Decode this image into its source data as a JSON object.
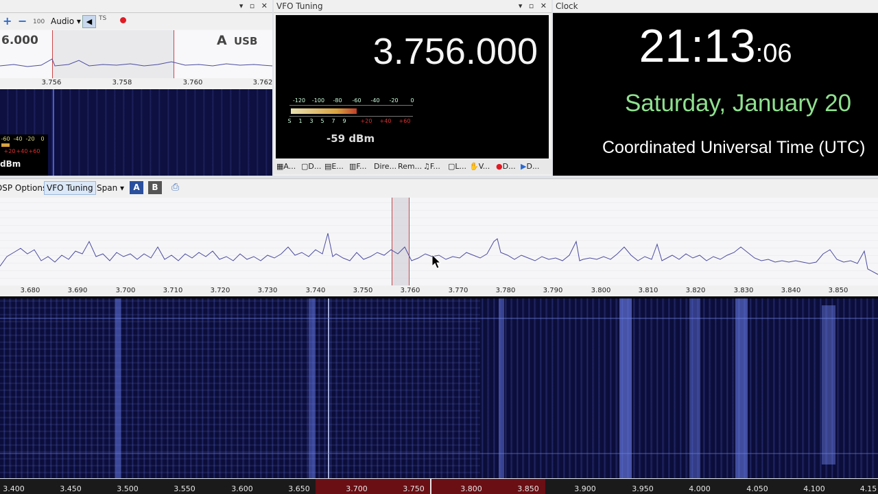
{
  "left_panel": {
    "toolbar": {
      "plus": "+",
      "minus": "−",
      "level": "100",
      "audio_label": "Audio",
      "record_icon": "record-icon"
    },
    "freq_partial": "6.000",
    "vfo_letter": "A",
    "mode": "USB",
    "ticks": [
      "3.756",
      "3.758",
      "3.760",
      "3.762"
    ],
    "meter_labels": [
      "-60",
      "-40",
      "-20",
      "0"
    ],
    "meter_red": [
      "+20",
      "+40",
      "+60"
    ],
    "dbm_partial": "dBm"
  },
  "vfo_panel": {
    "title": "VFO Tuning",
    "frequency": "3.756.000",
    "meter_labels": [
      "-120",
      "-100",
      "-80",
      "-60",
      "-40",
      "-20",
      "0"
    ],
    "s_labels": [
      "S",
      "1",
      "3",
      "5",
      "7",
      "9"
    ],
    "plus_labels": [
      "+20",
      "+40",
      "+60"
    ],
    "dbm": "-59 dBm",
    "tabs": [
      "A...",
      "D...",
      "E...",
      "F...",
      "Dire...",
      "Rem...",
      "F...",
      "L...",
      "V...",
      "D...",
      "D..."
    ]
  },
  "clock_panel": {
    "title": "Clock",
    "time_main": "21:13",
    "time_seconds": ":06",
    "date": "Saturday, January 20",
    "timezone": "Coordinated Universal Time (UTC)"
  },
  "main_toolbar": {
    "dsp_options": "DSP Options",
    "vfo_tuning": "VFO Tuning",
    "span": "Span",
    "a": "A",
    "b": "B"
  },
  "spectrum": {
    "ticks": [
      "3.680",
      "3.690",
      "3.700",
      "3.710",
      "3.720",
      "3.730",
      "3.740",
      "3.750",
      "3.760",
      "3.770",
      "3.780",
      "3.790",
      "3.800",
      "3.810",
      "3.820",
      "3.830",
      "3.840",
      "3.850"
    ]
  },
  "bottom_scale": {
    "ticks": [
      "3.400",
      "3.450",
      "3.500",
      "3.550",
      "3.600",
      "3.650",
      "3.700",
      "3.750",
      "3.800",
      "3.850",
      "3.900",
      "3.950",
      "4.000",
      "4.050",
      "4.100",
      "4.15"
    ]
  },
  "colors": {
    "waterfall_bg": "#0b0d3a",
    "clock_date": "#8fe08f",
    "meter_red": "#e03030"
  }
}
